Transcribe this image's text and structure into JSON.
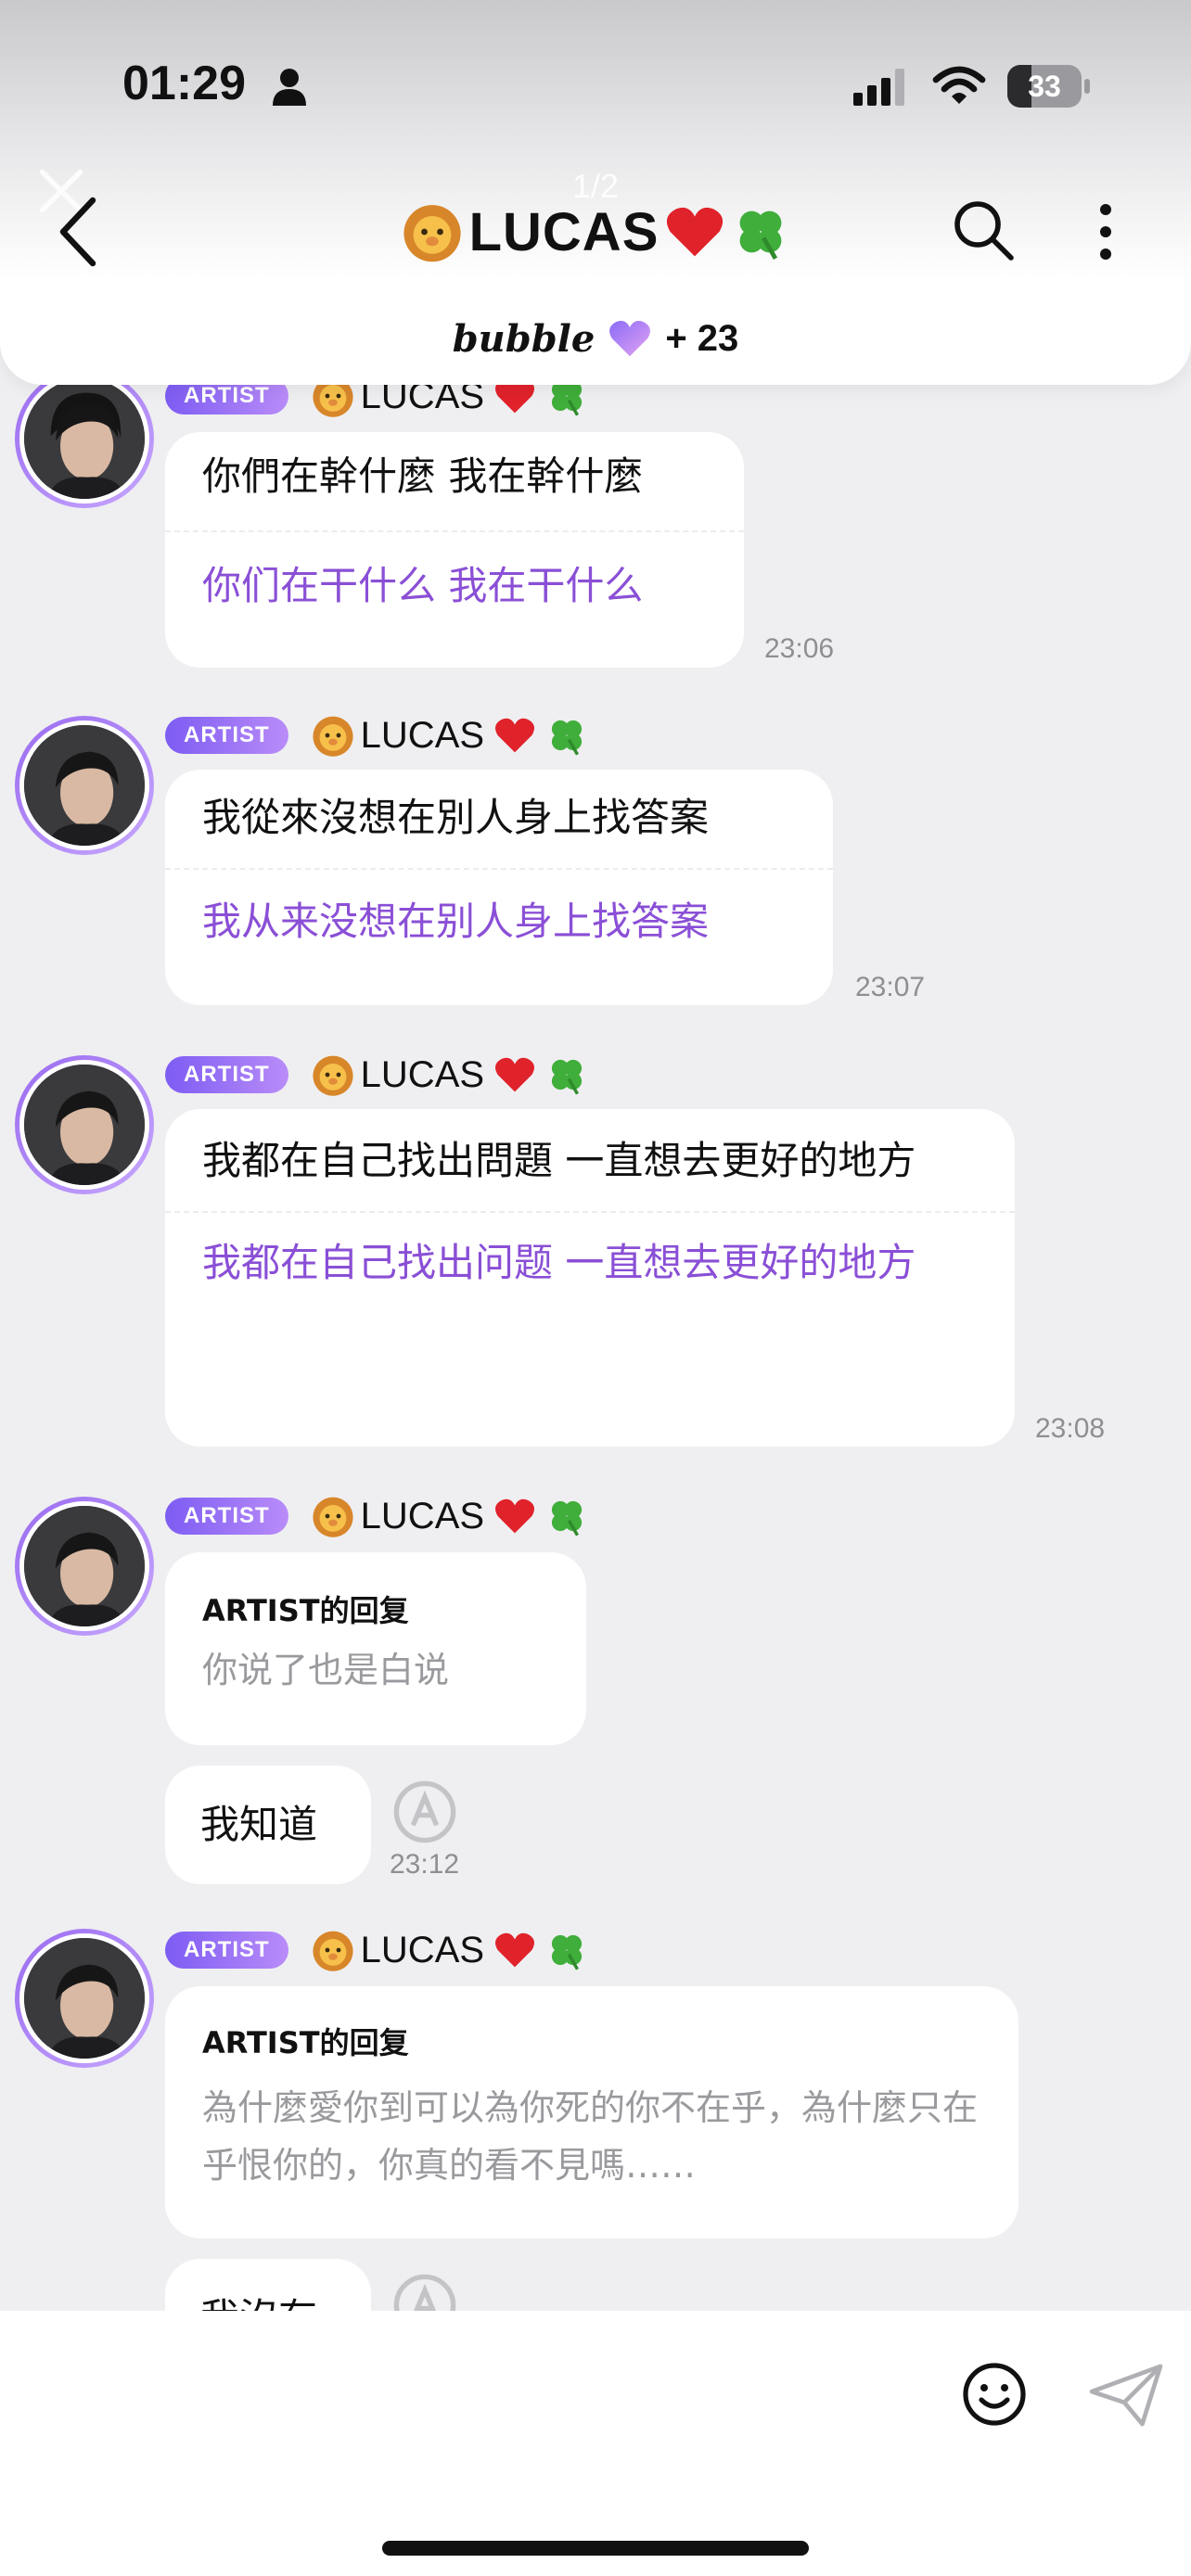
{
  "status_bar": {
    "time": "01:29",
    "battery": "33",
    "battery_level_percent": 33
  },
  "header": {
    "page_indicator": "1/2",
    "title": "LUCAS",
    "title_emojis": [
      "lion-face",
      "red-heart",
      "four-leaf-clover"
    ],
    "brand": "bubble",
    "subscriber_extra": "+ 23"
  },
  "messages": [
    {
      "badge": "ARTIST",
      "sender": "LUCAS",
      "original": "你們在幹什麼 我在幹什麼",
      "translation": "你们在干什么 我在干什么",
      "time": "23:06"
    },
    {
      "badge": "ARTIST",
      "sender": "LUCAS",
      "original": "我從來沒想在別人身上找答案",
      "translation": "我从来没想在别人身上找答案",
      "time": "23:07"
    },
    {
      "badge": "ARTIST",
      "sender": "LUCAS",
      "original": "我都在自己找出問題 一直想去更好的地方",
      "translation": "我都在自己找出问题 一直想去更好的地方",
      "time": "23:08"
    },
    {
      "badge": "ARTIST",
      "sender": "LUCAS",
      "reply_title": "ARTIST的回复",
      "reply_text": "你说了也是白说",
      "answer": "我知道",
      "time": "23:12"
    },
    {
      "badge": "ARTIST",
      "sender": "LUCAS",
      "reply_title": "ARTIST的回复",
      "reply_text": "為什麼愛你到可以為你死的你不在乎，為什麼只在乎恨你的，你真的看不見嗎……",
      "answer": "我沒有"
    }
  ],
  "input": {
    "placeholder": ""
  },
  "colors": {
    "accent_purple": "#8a4fd6",
    "badge_gradient_start": "#7d5cf3",
    "badge_gradient_end": "#b98cf8",
    "chat_background": "#efeff1"
  }
}
